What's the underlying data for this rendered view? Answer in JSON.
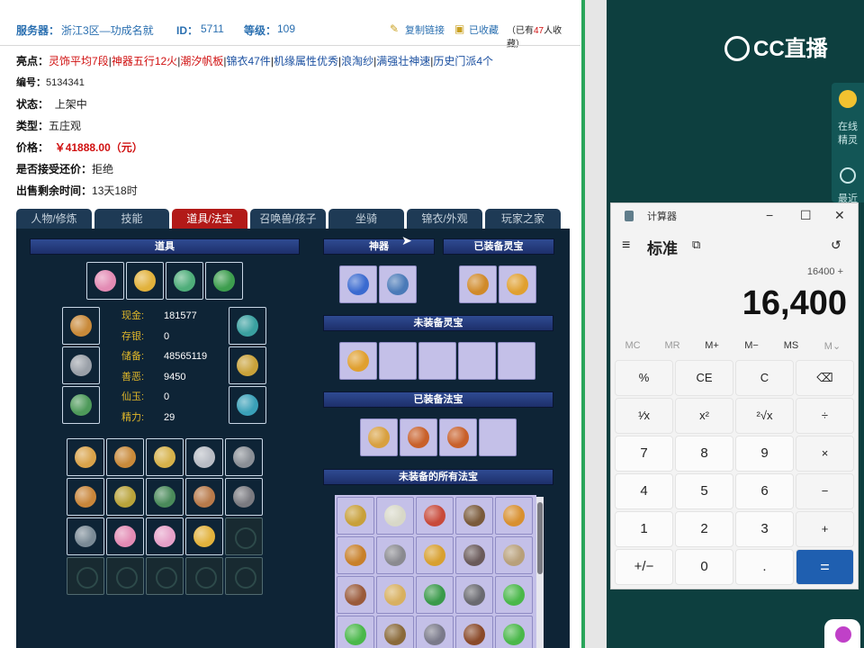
{
  "header": {
    "server_label": "服务器：",
    "server_value": "浙江3区—功成名就",
    "id_label": "ID：",
    "id_value": "5711",
    "level_label": "等级：",
    "level_value": "109",
    "copy_link": "复制链接",
    "favorited": "已收藏",
    "fav_prefix": "（已有",
    "fav_count": "47",
    "fav_suffix": "人收藏）"
  },
  "listing": {
    "highlights_label": "亮点：",
    "highlights": [
      "灵饰平均7段",
      "神器五行12火",
      "潮汐帆板",
      "锦衣47件",
      "机缘属性优秀",
      "浪淘纱",
      "满强壮神速",
      "历史门派4个"
    ],
    "id_label": "编号：",
    "id_value": "5134341",
    "status_label": "状态：",
    "status_value": "上架中",
    "type_label": "类型：",
    "type_value": "五庄观",
    "price_label": "价格：",
    "price_value": "￥41888.00（元）",
    "counter_label": "是否接受还价：",
    "counter_value": "拒绝",
    "remaining_label": "出售剩余时间：",
    "remaining_value": "13天18时"
  },
  "tabs": [
    "人物/修炼",
    "技能",
    "道具/法宝",
    "召唤兽/孩子",
    "坐骑",
    "锦衣/外观",
    "玩家之家"
  ],
  "active_tab": 2,
  "panel": {
    "items_title": "道具",
    "artifact_title": "神器",
    "equipped_lingbao_title": "已装备灵宝",
    "unequipped_lingbao_title": "未装备灵宝",
    "equipped_fabao_title": "已装备法宝",
    "unequipped_fabao_title": "未装备的所有法宝",
    "stats": [
      {
        "label": "现金:",
        "value": "181577"
      },
      {
        "label": "存银:",
        "value": "0"
      },
      {
        "label": "储备:",
        "value": "48565119"
      },
      {
        "label": "善恶:",
        "value": "9450"
      },
      {
        "label": "仙玉:",
        "value": "0"
      },
      {
        "label": "精力:",
        "value": "29"
      }
    ]
  },
  "stream": {
    "logo": "CC直播",
    "side_online": "在线",
    "side_sprite": "精灵",
    "side_recent": "最近"
  },
  "calculator": {
    "app_title": "计算器",
    "mode": "标准",
    "expression": "16400 +",
    "display": "16,400",
    "memory": [
      "MC",
      "MR",
      "M+",
      "M−",
      "MS",
      "M⌄"
    ],
    "keys": [
      "%",
      "CE",
      "C",
      "⌫",
      "¹⁄x",
      "x²",
      "²√x",
      "÷",
      "7",
      "8",
      "9",
      "×",
      "4",
      "5",
      "6",
      "−",
      "1",
      "2",
      "3",
      "+",
      "+/−",
      "0",
      ".",
      "="
    ]
  },
  "colors": {
    "accent_red": "#d01010",
    "tab_active": "#b21a18",
    "panel_bg": "#0e2436",
    "calc_equals": "#1f5fb0"
  }
}
